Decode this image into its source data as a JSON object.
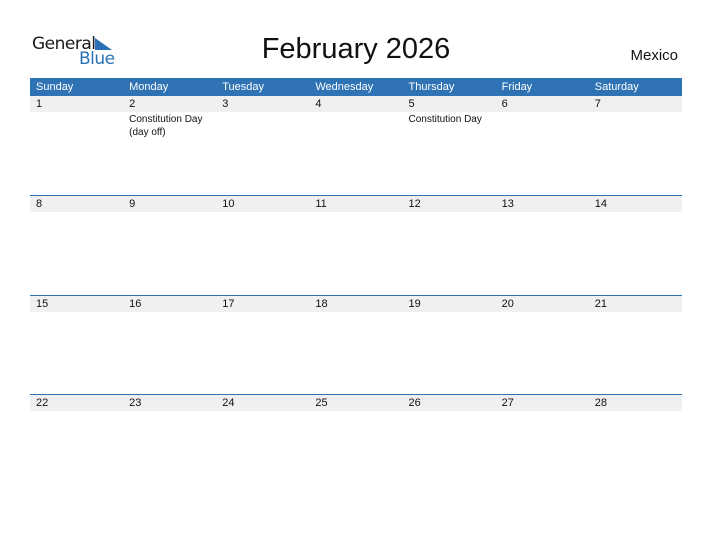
{
  "logo": {
    "line1": "General",
    "line2": "Blue",
    "icon": "blue-triangle-icon",
    "accent": "#2a72b5"
  },
  "title": "February 2026",
  "country": "Mexico",
  "colors": {
    "header_bg": "#2f73b4",
    "day_band": "#f0f0f0"
  },
  "weekdays": [
    "Sunday",
    "Monday",
    "Tuesday",
    "Wednesday",
    "Thursday",
    "Friday",
    "Saturday"
  ],
  "weeks": [
    {
      "days": [
        {
          "num": "1",
          "event": ""
        },
        {
          "num": "2",
          "event": "Constitution Day (day off)"
        },
        {
          "num": "3",
          "event": ""
        },
        {
          "num": "4",
          "event": ""
        },
        {
          "num": "5",
          "event": "Constitution Day"
        },
        {
          "num": "6",
          "event": ""
        },
        {
          "num": "7",
          "event": ""
        }
      ]
    },
    {
      "days": [
        {
          "num": "8",
          "event": ""
        },
        {
          "num": "9",
          "event": ""
        },
        {
          "num": "10",
          "event": ""
        },
        {
          "num": "11",
          "event": ""
        },
        {
          "num": "12",
          "event": ""
        },
        {
          "num": "13",
          "event": ""
        },
        {
          "num": "14",
          "event": ""
        }
      ]
    },
    {
      "days": [
        {
          "num": "15",
          "event": ""
        },
        {
          "num": "16",
          "event": ""
        },
        {
          "num": "17",
          "event": ""
        },
        {
          "num": "18",
          "event": ""
        },
        {
          "num": "19",
          "event": ""
        },
        {
          "num": "20",
          "event": ""
        },
        {
          "num": "21",
          "event": ""
        }
      ]
    },
    {
      "days": [
        {
          "num": "22",
          "event": ""
        },
        {
          "num": "23",
          "event": ""
        },
        {
          "num": "24",
          "event": ""
        },
        {
          "num": "25",
          "event": ""
        },
        {
          "num": "26",
          "event": ""
        },
        {
          "num": "27",
          "event": ""
        },
        {
          "num": "28",
          "event": ""
        }
      ]
    }
  ]
}
